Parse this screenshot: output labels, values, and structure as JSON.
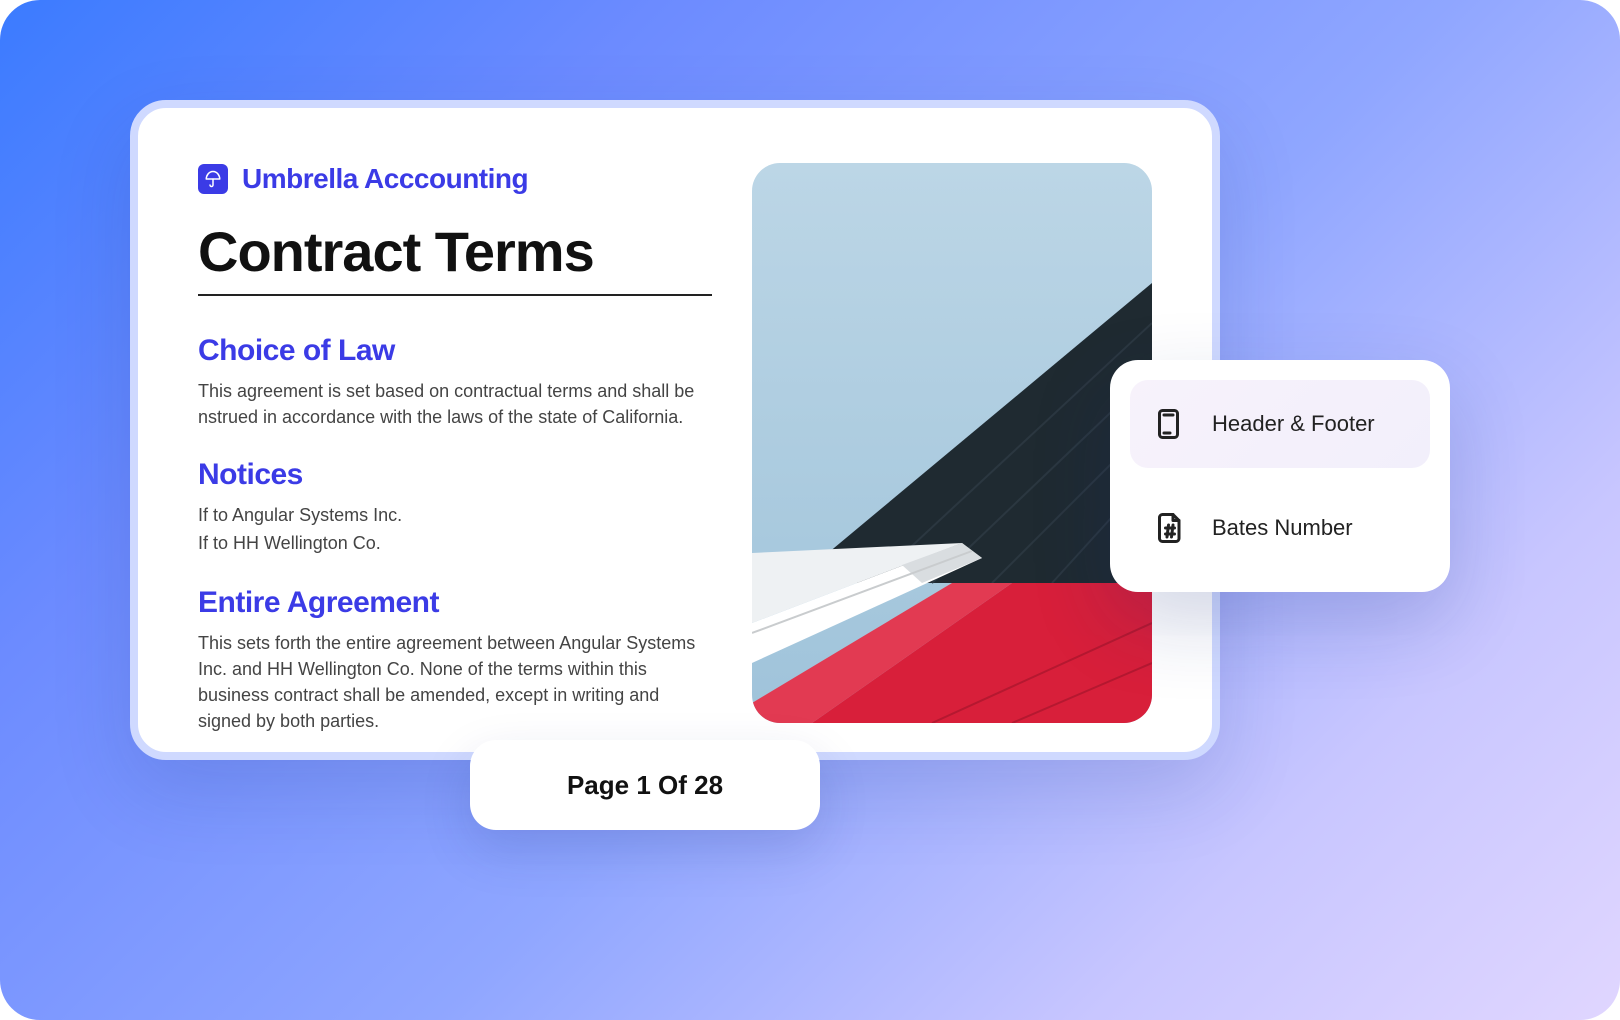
{
  "document": {
    "brand_name": "Umbrella Acccounting",
    "title": "Contract Terms",
    "sections": {
      "choice_of_law": {
        "heading": "Choice of Law",
        "body": "This agreement is set based on contractual terms and shall be nstrued in accordance with the laws of the state of California."
      },
      "notices": {
        "heading": "Notices",
        "lines": [
          "If to Angular Systems Inc.",
          "If to HH Wellington Co."
        ]
      },
      "entire_agreement": {
        "heading": "Entire Agreement",
        "body": "This sets forth the entire agreement between Angular Systems Inc. and HH Wellington Co. None of the terms within this business contract shall be amended, except in writing and signed by both parties."
      }
    }
  },
  "page_indicator": {
    "label": "Page 1 Of 28"
  },
  "options": {
    "header_footer": {
      "label": "Header & Footer"
    },
    "bates_number": {
      "label": "Bates Number"
    }
  }
}
